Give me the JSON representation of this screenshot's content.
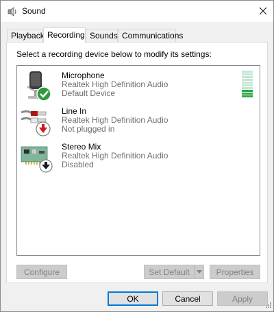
{
  "window": {
    "title": "Sound",
    "close_icon": "close-icon",
    "title_icon": "speaker-icon"
  },
  "tabs": [
    {
      "label": "Playback",
      "active": false
    },
    {
      "label": "Recording",
      "active": true
    },
    {
      "label": "Sounds",
      "active": false
    },
    {
      "label": "Communications",
      "active": false
    }
  ],
  "panel": {
    "instruction": "Select a recording device below to modify its settings:"
  },
  "devices": [
    {
      "name": "Microphone",
      "description": "Realtek High Definition Audio",
      "status": "Default Device",
      "icon": "microphone-icon",
      "badge": "default-check-icon",
      "level": 0.3
    },
    {
      "name": "Line In",
      "description": "Realtek High Definition Audio",
      "status": "Not plugged in",
      "icon": "line-in-jack-icon",
      "badge": "unplugged-arrow-icon"
    },
    {
      "name": "Stereo Mix",
      "description": "Realtek High Definition Audio",
      "status": "Disabled",
      "icon": "sound-card-icon",
      "badge": "disabled-arrow-icon"
    }
  ],
  "buttons": {
    "configure": "Configure",
    "set_default": "Set Default",
    "properties": "Properties",
    "ok": "OK",
    "cancel": "Cancel",
    "apply": "Apply"
  },
  "colors": {
    "selection_accent": "#0078d7",
    "meter_active": "#2aa845",
    "meter_inactive": "#c6e6d8",
    "default_badge": "#2d9a3c",
    "unplugged_badge": "#d01919"
  }
}
